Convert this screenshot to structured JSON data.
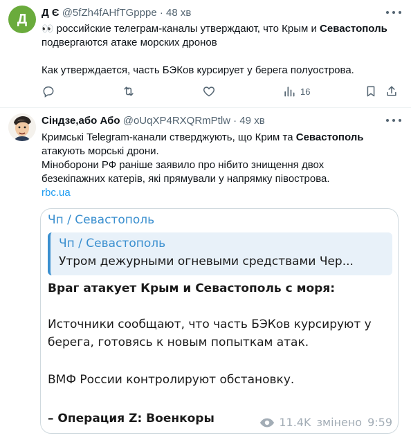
{
  "tweet1": {
    "avatar_letter": "Д",
    "name": "Д Є",
    "handle": "@5fZh4fAHfTGpppe",
    "dot": "·",
    "time": "48 хв",
    "eyes_emoji": "👀",
    "line1_a": "российские телеграм-каналы утверждают, что Крым и ",
    "line1_bold": "Севастополь",
    "line2": "подвергаются атаке морских дронов",
    "line3": "Как утверждается, часть БЭКов курсирует у берега полуострова.",
    "views": "16"
  },
  "tweet2": {
    "name": "Сіндзе,або Або",
    "handle": "@oUqXP4RXQRmPtlw",
    "dot": "·",
    "time": "49 хв",
    "line1_a": "Кримські Telegram-канали стверджують, що Крим та ",
    "line1_bold": "Севастополь",
    "line2": "атакують морські дрони.",
    "line3": "Міноборони РФ раніше заявило про нібито знищення двох",
    "line4": "безекіпажних катерів, які прямували у напрямку півострова.",
    "link": "rbc.ua",
    "card": {
      "channel_title": "Чп / Севастополь",
      "quote_title": "Чп / Севастополь",
      "quote_text": "Утром дежурными огневыми средствами Чер...",
      "headline": "Враг атакует Крым и Севастополь с моря:",
      "para1_line1": "Источники сообщают, что часть БЭКов курсируют у",
      "para1_line2": "берега, готовясь к новым попыткам атак.",
      "para2": "ВМФ России контролируют обстановку.",
      "signature": "– Операция Z: Военкоры",
      "views": "11.4K",
      "edited": "змінено",
      "time": "9:59"
    }
  },
  "colors": {
    "accent": "#1d9bf0",
    "avatar_green": "#6aab3c",
    "telegram_blue": "#3a8fcf",
    "muted": "#536471"
  }
}
